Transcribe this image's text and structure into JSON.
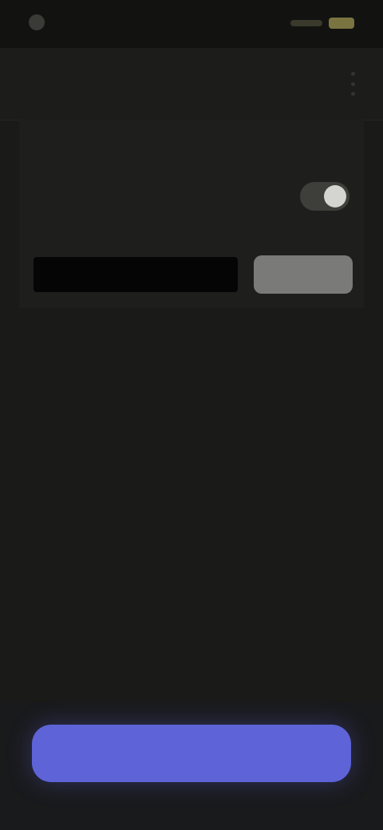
{
  "status_bar": {
    "time": "",
    "icons": [
      "app-icon",
      "signal-icon",
      "battery-icon"
    ]
  },
  "header": {
    "title": "",
    "menu_icon": "kebab-menu-icon"
  },
  "settings": {
    "row1_label": "",
    "row1_link": "",
    "row2_label": "",
    "row2_toggle_on": true,
    "row3_label": "",
    "input_value": "",
    "input_placeholder": "",
    "action_label": ""
  },
  "footer": {
    "primary_label": ""
  },
  "colors": {
    "background": "#1a1b19",
    "accent": "#5e63d8",
    "link": "#2b3454",
    "input_bg": "#050505"
  }
}
